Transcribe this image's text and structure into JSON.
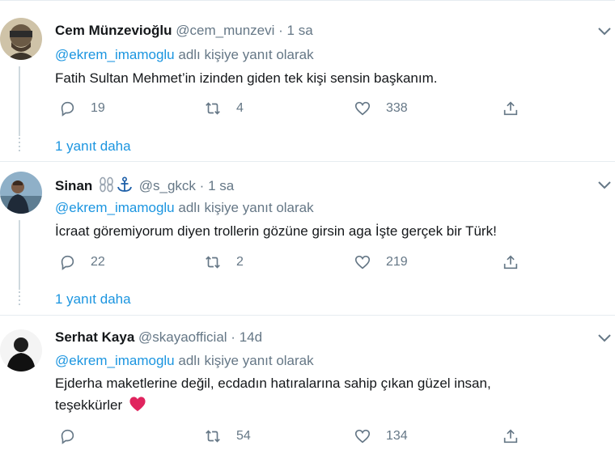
{
  "tweets": [
    {
      "name": "Cem Münzevioğlu",
      "handle": "@cem_munzevi",
      "time": "1 sa",
      "reply_handle": "@ekrem_imamoglu",
      "reply_suffix": "adlı kişiye yanıt olarak",
      "text": "Fatih Sultan Mehmet’in izinden giden tek kişi sensin başkanım.",
      "replies": "19",
      "retweets": "4",
      "likes": "338",
      "more": "1 yanıt daha"
    },
    {
      "name": "Sinan",
      "handle": "@s_gkck",
      "time": "1 sa",
      "reply_handle": "@ekrem_imamoglu",
      "reply_suffix": "adlı kişiye yanıt olarak",
      "text": "İcraat göremiyorum diyen trollerin gözüne girsin aga İşte gerçek bir Türk!",
      "replies": "22",
      "retweets": "2",
      "likes": "219",
      "more": "1 yanıt daha"
    },
    {
      "name": "Serhat Kaya",
      "handle": "@skayaofficial",
      "time": "14d",
      "reply_handle": "@ekrem_imamoglu",
      "reply_suffix": "adlı kişiye yanıt olarak",
      "text_line1": "Ejderha maketlerine değil, ecdadın hatıralarına sahip çıkan güzel insan,",
      "text_line2": "teşekkürler",
      "retweets": "54",
      "likes": "134"
    }
  ],
  "icons": {
    "reply": "reply-icon",
    "retweet": "retweet-icon",
    "like": "heart-icon",
    "share": "share-icon",
    "menu": "chevron-down-icon",
    "emoji_heart": "red-heart-emoji",
    "name_emoji": "chain-anchor-emoji"
  },
  "colors": {
    "link": "#1b95e0",
    "muted": "#657786",
    "heart": "#e0245e"
  }
}
